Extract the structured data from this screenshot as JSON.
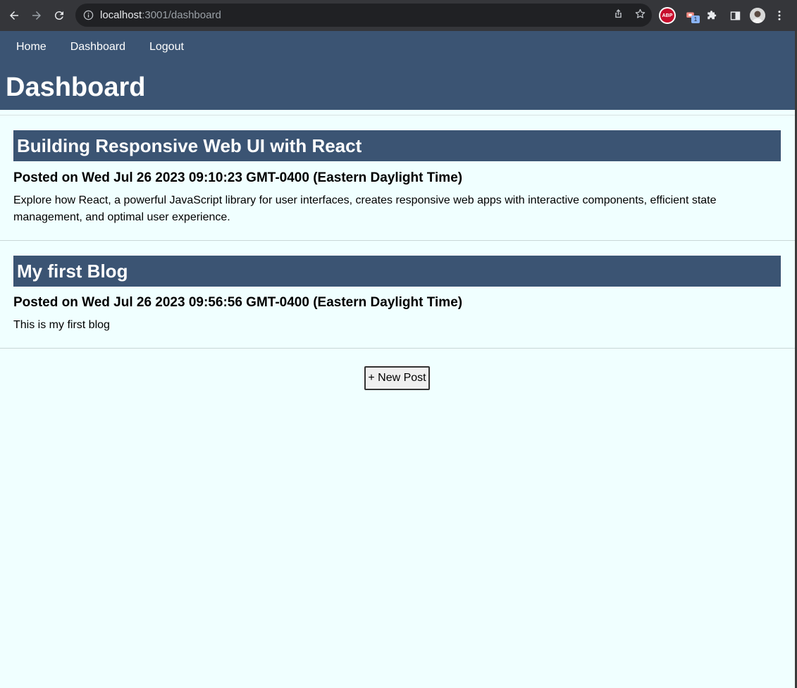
{
  "browser": {
    "url_host": "localhost",
    "url_rest": ":3001/dashboard",
    "icons": [
      "back-arrow-icon",
      "forward-arrow-icon",
      "reload-icon",
      "info-icon",
      "share-icon",
      "star-icon",
      "adblock-icon",
      "extension-icon",
      "puzzle-icon",
      "side-panel-icon",
      "profile-avatar",
      "more-menu-icon"
    ],
    "abp_label": "ABP",
    "ext_badge": "1"
  },
  "nav": {
    "items": [
      {
        "label": "Home"
      },
      {
        "label": "Dashboard"
      },
      {
        "label": "Logout"
      }
    ]
  },
  "page": {
    "title": "Dashboard"
  },
  "posts": [
    {
      "title": "Building Responsive Web UI with React",
      "date": "Posted on Wed Jul 26 2023 09:10:23 GMT-0400 (Eastern Daylight Time)",
      "body": "Explore how React, a powerful JavaScript library for user interfaces, creates responsive web apps with interactive components, efficient state management, and optimal user experience."
    },
    {
      "title": "My first Blog",
      "date": "Posted on Wed Jul 26 2023 09:56:56 GMT-0400 (Eastern Daylight Time)",
      "body": "This is my first blog"
    }
  ],
  "actions": {
    "new_post_label": "+ New Post"
  },
  "colors": {
    "header_bg": "#3b5473",
    "page_bg": "#f0ffff",
    "chrome_bg": "#35363a"
  }
}
